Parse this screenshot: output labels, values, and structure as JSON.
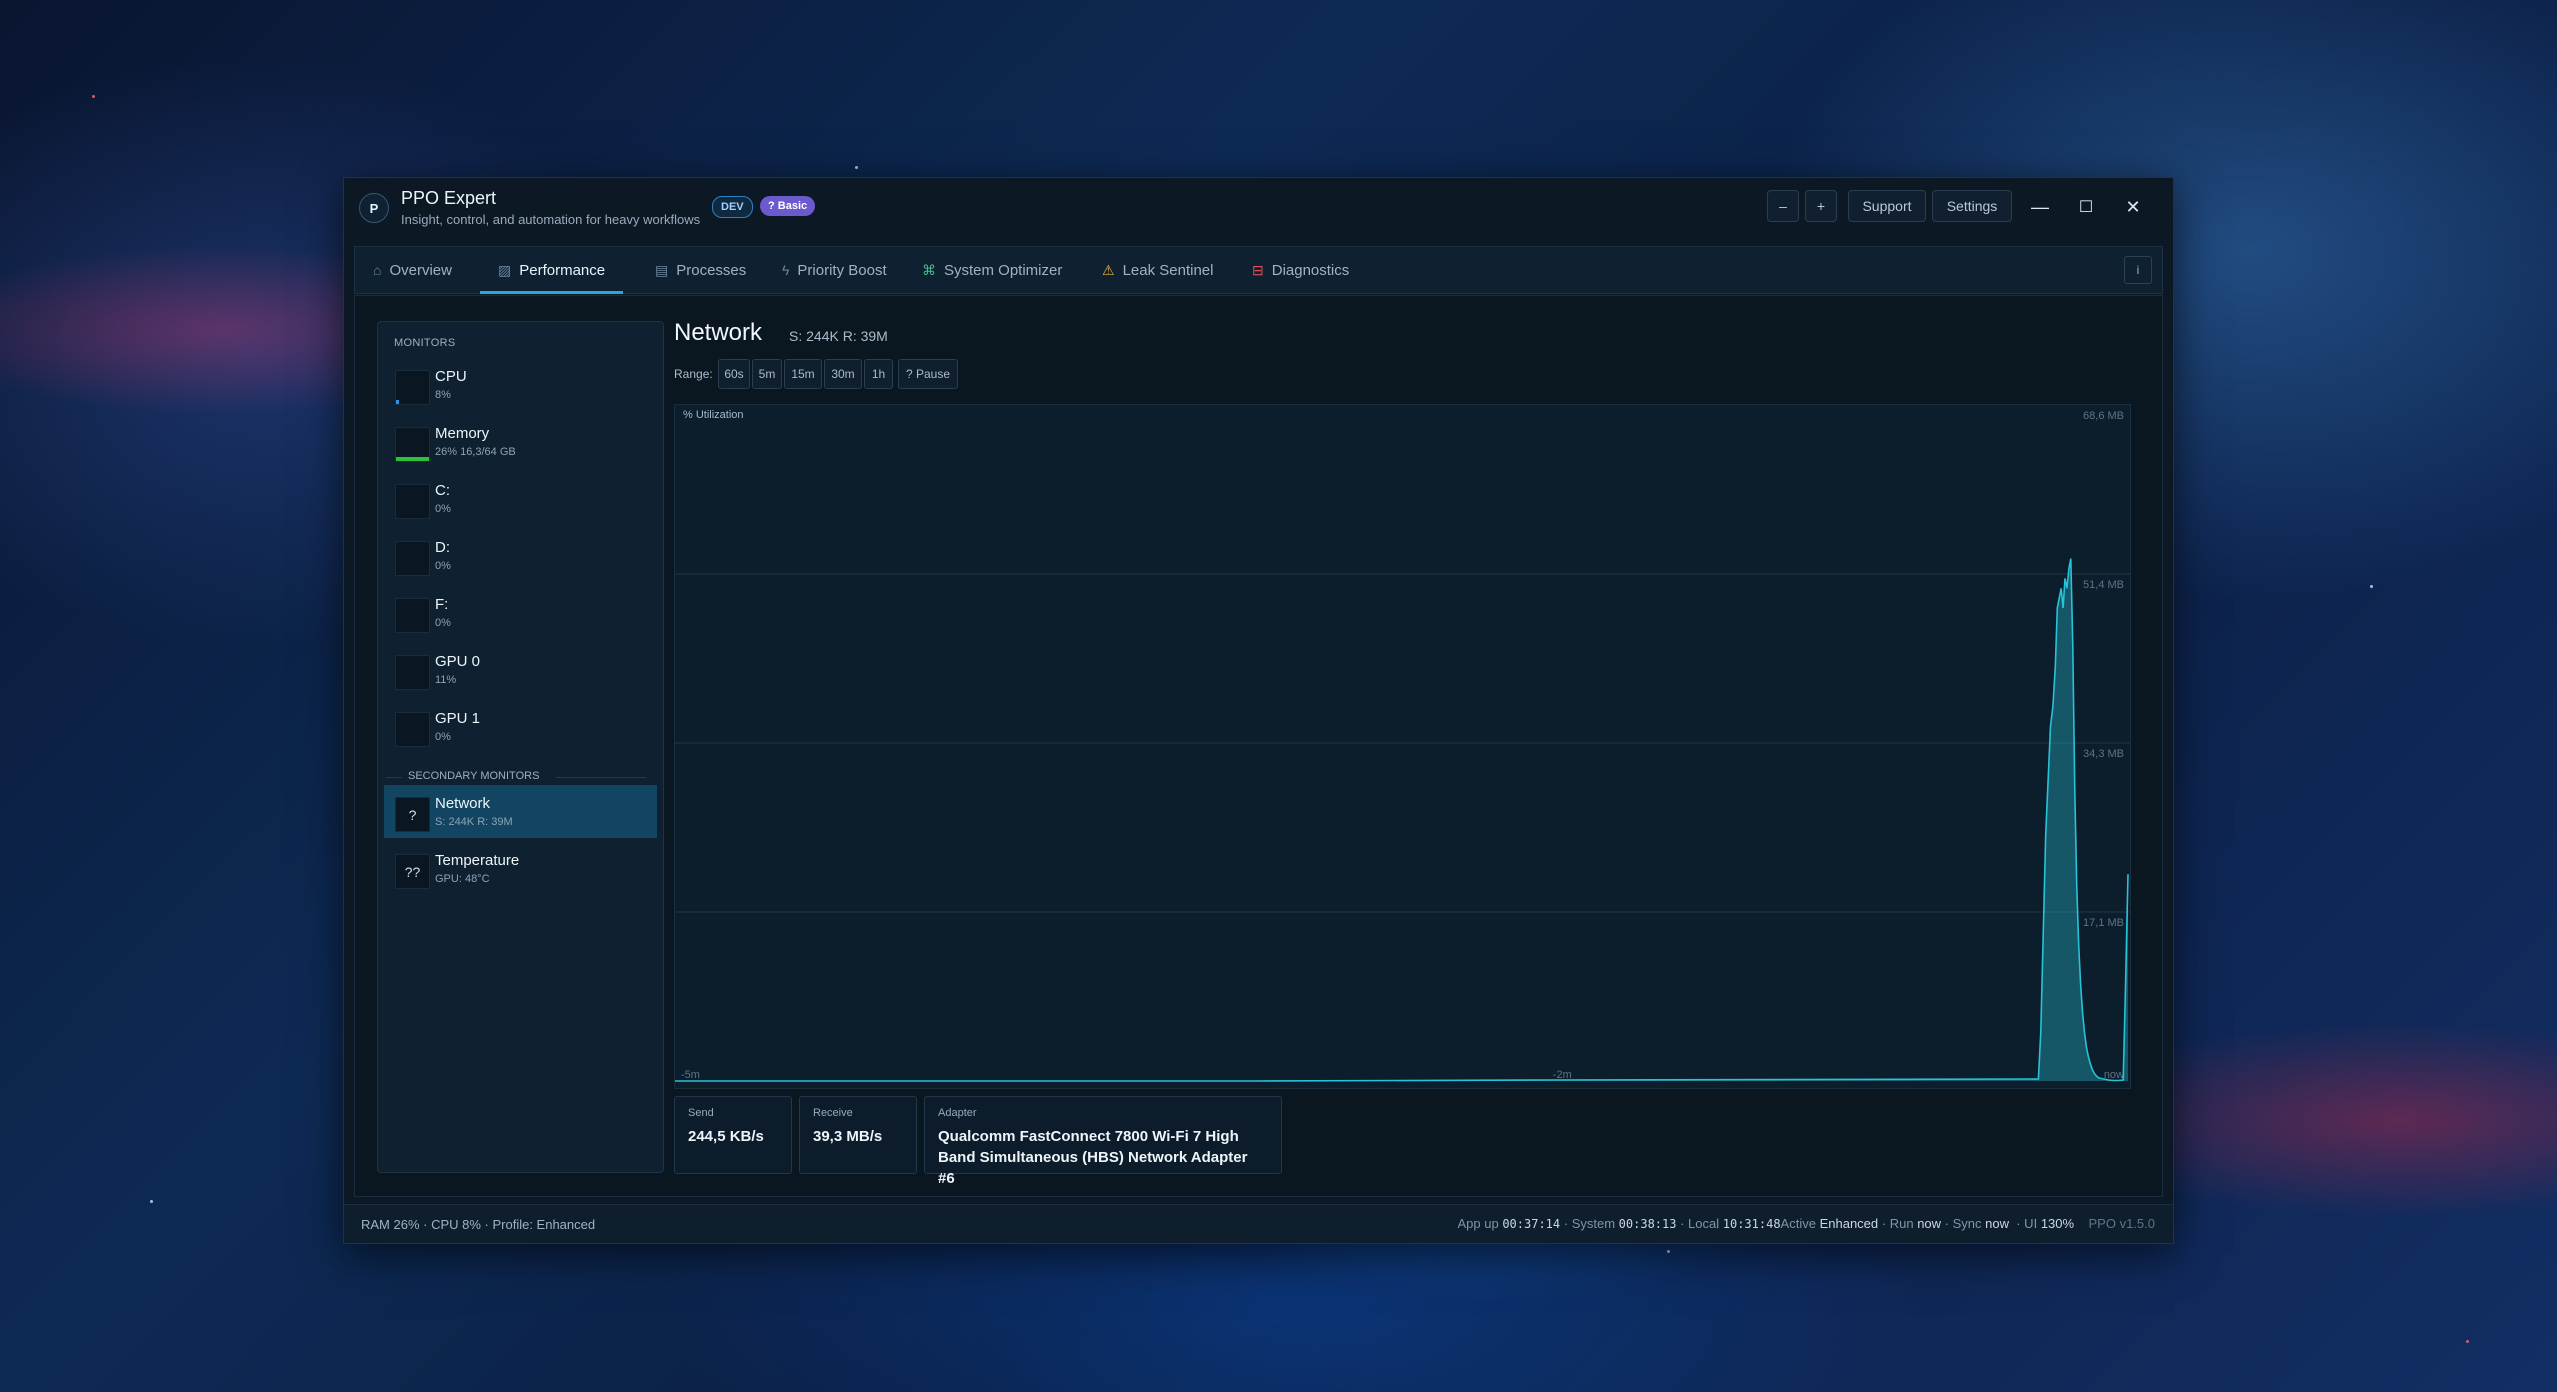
{
  "app": {
    "title": "PPO Expert",
    "subtitle": "Insight, control, and automation for heavy workflows",
    "logo_letter": "P",
    "badge_dev": "DEV",
    "badge_tier": "? Basic"
  },
  "titlebar": {
    "zoom_out_label": "–",
    "zoom_in_label": "+",
    "support_label": "Support",
    "settings_label": "Settings",
    "minimize_glyph": "—",
    "maximize_glyph": "☐",
    "close_glyph": "✕"
  },
  "tabs": [
    {
      "label": "Overview",
      "icon": "home-icon",
      "glyph": "⌂"
    },
    {
      "label": "Performance",
      "icon": "chart-icon",
      "glyph": "▨",
      "active": true
    },
    {
      "label": "Processes",
      "icon": "document-icon",
      "glyph": "▤"
    },
    {
      "label": "Priority Boost",
      "icon": "bolt-icon",
      "glyph": "ϟ"
    },
    {
      "label": "System Optimizer",
      "icon": "gamepad-icon",
      "glyph": "⌘"
    },
    {
      "label": "Leak Sentinel",
      "icon": "warning-icon",
      "glyph": "⚠"
    },
    {
      "label": "Diagnostics",
      "icon": "toolbox-icon",
      "glyph": "⊟"
    }
  ],
  "tab_info_label": "i",
  "sidebar": {
    "header": "MONITORS",
    "monitors": [
      {
        "name": "CPU",
        "sub": "8%",
        "level": 0.08,
        "bar_color": "#2f8fe0"
      },
      {
        "name": "Memory",
        "sub": "26%  16,3/64 GB",
        "level": 1.0,
        "bar_color": "#2fbf3a"
      },
      {
        "name": "C:",
        "sub": "0%"
      },
      {
        "name": "D:",
        "sub": "0%"
      },
      {
        "name": "F:",
        "sub": "0%"
      },
      {
        "name": "GPU 0",
        "sub": "11%"
      },
      {
        "name": "GPU 1",
        "sub": "0%"
      }
    ],
    "secondary_header": "SECONDARY MONITORS",
    "secondary": [
      {
        "name": "Network",
        "sub": "S: 244K  R: 39M",
        "glyph": "?",
        "selected": true
      },
      {
        "name": "Temperature",
        "sub": "GPU: 48°C",
        "glyph": "??"
      }
    ]
  },
  "main": {
    "title": "Network",
    "stats": "S: 244K  R: 39M",
    "range_label": "Range:",
    "ranges": [
      "60s",
      "5m",
      "15m",
      "30m",
      "1h",
      "? Pause"
    ]
  },
  "chart_data": {
    "type": "area",
    "ylabel": "% Utilization",
    "y_ticks": [
      "68,6 MB",
      "51,4 MB",
      "34,3 MB",
      "17,1 MB"
    ],
    "x_ticks": [
      "-5m",
      "-2m",
      "now"
    ],
    "ylim_mb": [
      0,
      68.6
    ],
    "line_color": "#27c3d8",
    "grid": true,
    "series": [
      {
        "x_seconds": [
          -300,
          -180,
          -120,
          -18.5,
          -18,
          -17,
          -16,
          -15.5,
          -15,
          -14.6,
          -14.2,
          -13.8,
          -13.4,
          -13,
          -12.6,
          -12.2,
          -11.8,
          -11.4,
          -11,
          -10.6,
          -10.2,
          -9.8,
          -9.4,
          -9,
          -8.6,
          -8.2,
          -7.8,
          -7.4,
          -7,
          -6.5,
          -6,
          -5,
          -4,
          -3,
          -2,
          -1,
          -0.5,
          0
        ],
        "values_mb": [
          0,
          0,
          0.1,
          0.2,
          5,
          25,
          36,
          38,
          42,
          48,
          49,
          50,
          48,
          51,
          50,
          52,
          53,
          44,
          30,
          20,
          14,
          10,
          7,
          5,
          3.5,
          2.5,
          1.8,
          1.2,
          0.8,
          0.5,
          0.3,
          0.2,
          0.1,
          0.05,
          0.05,
          0.1,
          10,
          21
        ]
      }
    ]
  },
  "cards": [
    {
      "label": "Send",
      "value": "244,5 KB/s"
    },
    {
      "label": "Receive",
      "value": "39,3 MB/s"
    },
    {
      "label": "Adapter",
      "value": "Qualcomm FastConnect 7800 Wi-Fi 7 High Band Simultaneous (HBS) Network Adapter #6"
    }
  ],
  "status": {
    "left": "RAM 26%  ·  CPU 8%  ·  Profile: Enhanced",
    "app_up_label": "App up",
    "app_up": "00:37:14",
    "system_label": "· System",
    "system": "00:38:13",
    "local_label": "· Local",
    "local": "10:31:48",
    "active_label": "Active",
    "active": "Enhanced",
    "run_label": "· Run",
    "run": "now",
    "sync_label": "· Sync",
    "sync": "now",
    "ui_label": "· UI",
    "ui": "130%",
    "version": "PPO v1.5.0"
  }
}
